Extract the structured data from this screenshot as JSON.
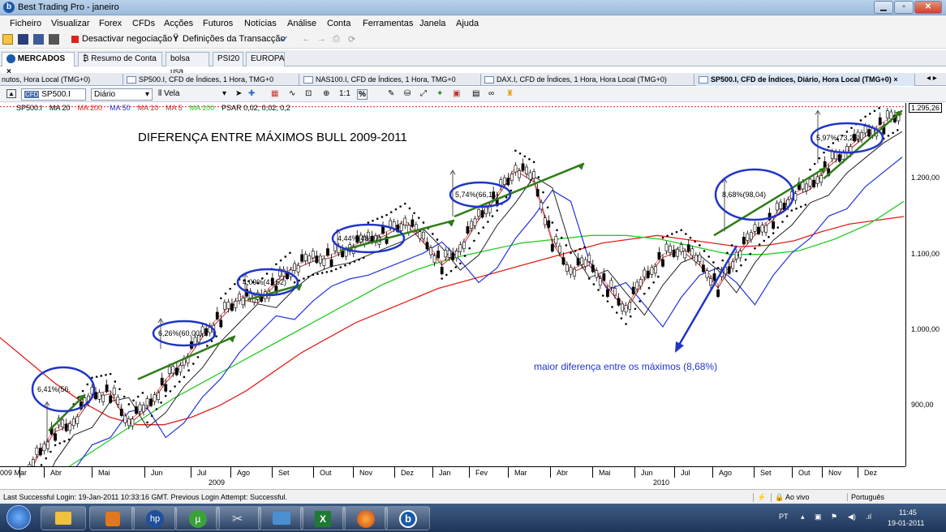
{
  "window": {
    "title": "Best Trading Pro - janeiro"
  },
  "menu": [
    "Ficheiro",
    "Visualizar",
    "Forex",
    "CFDs",
    "Acções",
    "Futuros",
    "Notícias",
    "Análise",
    "Conta",
    "Ferramentas",
    "Janela",
    "Ajuda"
  ],
  "toolbar": {
    "deactivate": "Desactivar negociação",
    "settings": "Definições da Transacção"
  },
  "doc_tabs": [
    "MERCADOS",
    "Resumo de Conta",
    "bolsa usa",
    "PSI20",
    "EUROPA"
  ],
  "chart_tabs": [
    "nutos, Hora Local (TMG+0)",
    "SP500.I, CFD de Índices, 1 Hora, TMG+0",
    "NAS100.I, CFD de Índices, 1 Hora, TMG+0",
    "DAX.I, CFD de Índices, 1 Hora, Hora Local (TMG+0)",
    "SP500.I, CFD de Índices, Diário, Hora Local (TMG+0)"
  ],
  "chart_toolbar": {
    "symbol": "SP500.I",
    "period": "Diário",
    "style": "Vela"
  },
  "chart_data": {
    "type": "line",
    "title": "DIFERENÇA ENTRE MÁXIMOS BULL 2009-2011",
    "legend": [
      "SP500.I",
      "MA 20",
      "MA 200",
      "MA 50",
      "MA 10",
      "MA 5",
      "MA 100",
      "PSAR 0,02; 0,02; 0,2"
    ],
    "last_price": "1.295,26",
    "y_ticks": [
      "1.200,00",
      "1.100,00",
      "1.000,00",
      "900,00"
    ],
    "ylim": [
      820,
      1300
    ],
    "x_months": [
      "009 Mar",
      "Abr",
      "Mai",
      "Jun",
      "Jul",
      "Ago",
      "Set",
      "Out",
      "Nov",
      "Dez",
      "Jan",
      "Fev",
      "Mar",
      "Abr",
      "Mai",
      "Jun",
      "Jul",
      "Ago",
      "Set",
      "Out",
      "Nov",
      "Dez"
    ],
    "x_years": [
      "2009",
      "2010"
    ],
    "price_series": {
      "name": "SP500.I",
      "values": [
        730,
        780,
        835,
        870,
        880,
        915,
        920,
        880,
        900,
        935,
        960,
        995,
        1020,
        1045,
        1040,
        1065,
        1085,
        1095,
        1100,
        1110,
        1120,
        1130,
        1145,
        1120,
        1090,
        1110,
        1150,
        1180,
        1215,
        1200,
        1120,
        1080,
        1090,
        1060,
        1030,
        1070,
        1100,
        1110,
        1090,
        1060,
        1100,
        1130,
        1150,
        1180,
        1190,
        1220,
        1240,
        1260,
        1275,
        1290
      ]
    },
    "ma200": {
      "name": "MA 200",
      "values": [
        990,
        960,
        930,
        905,
        885,
        875,
        875,
        885,
        900,
        920,
        945,
        970,
        990,
        1010,
        1025,
        1040,
        1055,
        1065,
        1075,
        1085,
        1095,
        1105,
        1115,
        1120,
        1125,
        1120,
        1115,
        1110,
        1112,
        1118,
        1130,
        1140,
        1145,
        1150
      ]
    },
    "ma100": {
      "name": "MA 100",
      "values": [
        770,
        790,
        820,
        850,
        880,
        910,
        935,
        960,
        985,
        1010,
        1035,
        1060,
        1080,
        1095,
        1105,
        1115,
        1120,
        1125,
        1125,
        1120,
        1110,
        1100,
        1100,
        1105,
        1120,
        1140,
        1170
      ]
    },
    "annotations": [
      {
        "label": "6,41%(56,",
        "value_pct": 6.41
      },
      {
        "label": "6,26%(60,00)",
        "value_pct": 6.26
      },
      {
        "label": "4,09%(41,52)",
        "value_pct": 4.09
      },
      {
        "label": "4,44%(48,97)",
        "value_pct": 4.44
      },
      {
        "label": "5,74%(66,11)",
        "value_pct": 5.74
      },
      {
        "label": "8,68%(98,04)",
        "value_pct": 8.68
      },
      {
        "label": "5,97%(73,23)",
        "value_pct": 5.97
      }
    ],
    "note": "maior diferença entre os máximos (8,68%)"
  },
  "status": {
    "login": "Last Successful Login: 19-Jan-2011 10:33:16 GMT. Previous Login Attempt: Successful.",
    "live": "Ao vivo",
    "language": "Português"
  },
  "tray": {
    "lang": "PT",
    "time": "11:45",
    "date": "19-01-2011"
  },
  "colors": {
    "green_line": "#2e7d18",
    "blue_circle": "#1f35c8",
    "ma200": "#e0201a",
    "ma100": "#22cc22",
    "ma50": "#2233dd"
  }
}
